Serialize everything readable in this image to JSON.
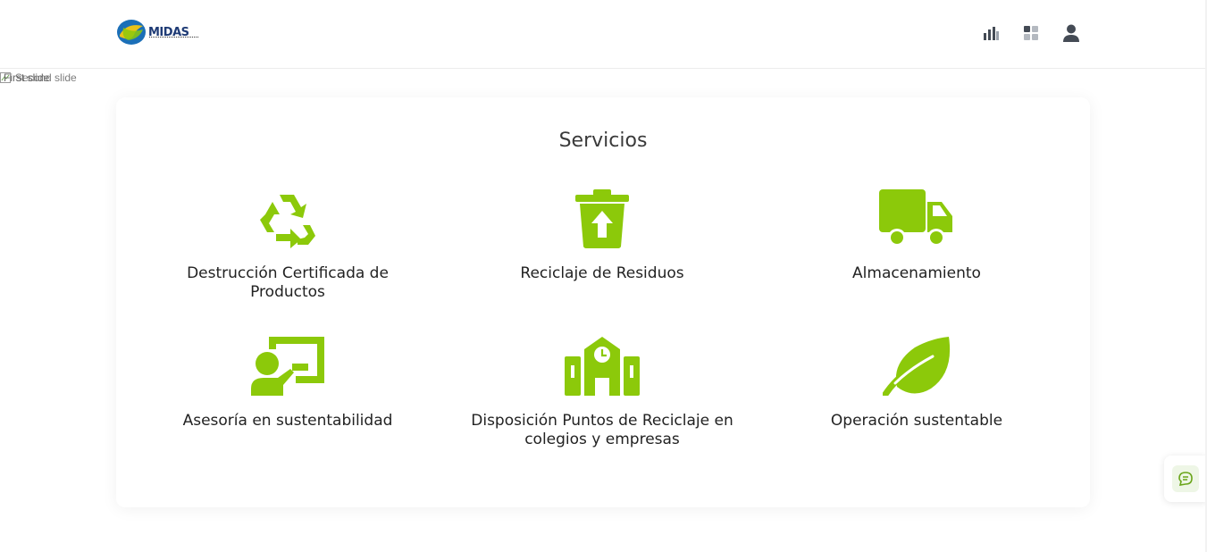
{
  "header": {
    "logo_text": "MIDAS",
    "nav_icons": [
      "bar-chart-icon",
      "grid-icon",
      "user-icon"
    ]
  },
  "broken_image": {
    "alt_1": "First slide",
    "alt_2": "Second slide"
  },
  "services": {
    "title": "Servicios",
    "items": [
      {
        "label": "Destrucción Certificada de Productos",
        "icon": "recycle-icon"
      },
      {
        "label": "Reciclaje de Residuos",
        "icon": "trash-upload-icon"
      },
      {
        "label": "Almacenamiento",
        "icon": "truck-icon"
      },
      {
        "label": "Asesoría en sustentabilidad",
        "icon": "presentation-icon"
      },
      {
        "label": "Disposición Puntos de Reciclaje en colegios y empresas",
        "icon": "school-icon"
      },
      {
        "label": "Operación sustentable",
        "icon": "leaf-icon"
      }
    ]
  },
  "colors": {
    "accent_green": "#8cc90a",
    "text_dark": "#222222",
    "nav_icon": "#444b55"
  }
}
